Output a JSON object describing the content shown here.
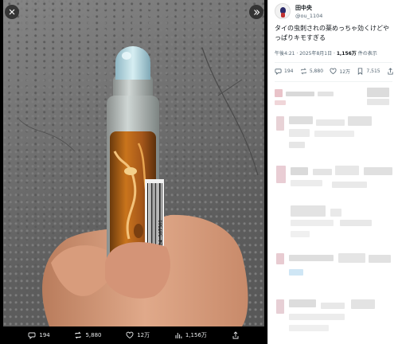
{
  "viewer": {
    "bottom_bar": {
      "reply_count": "194",
      "repost_count": "5,880",
      "like_count": "12万",
      "view_count": "1,156万"
    },
    "bottle_label_text": "8 857124 307502"
  },
  "tweet": {
    "display_name": "田中央",
    "handle": "@ou_1104",
    "text": "タイの虫刺されの薬めっちゃ効くけどやっぱりキモすぎる",
    "time": "午後4:21 · 2025年8月1日 · ",
    "views_number": "1,156万",
    "views_suffix": " 件の表示",
    "actions": {
      "reply_count": "194",
      "repost_count": "5,880",
      "like_count": "12万",
      "bookmark_count": "7,515"
    }
  },
  "colors": {
    "text_primary": "#0f1419",
    "text_secondary": "#536471",
    "viewer_background": "#000000"
  },
  "icons": [
    "close-icon",
    "chevron-right-icon",
    "reply-icon",
    "repost-icon",
    "like-icon",
    "views-icon",
    "bookmark-icon",
    "share-icon"
  ]
}
